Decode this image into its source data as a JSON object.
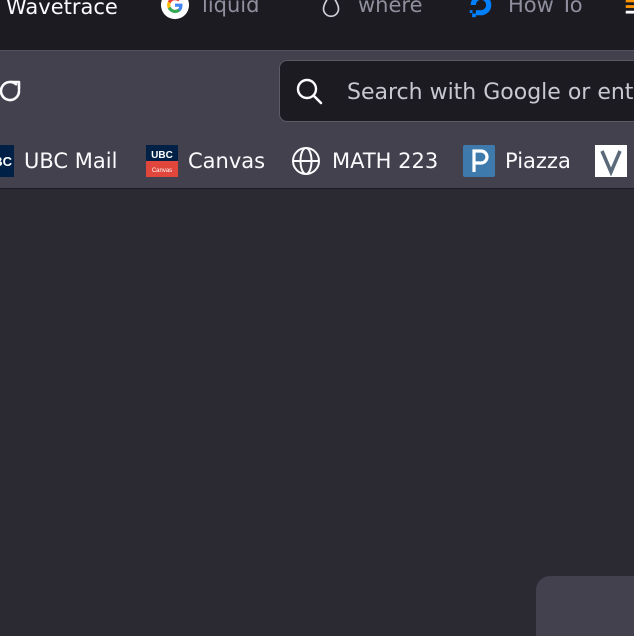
{
  "tabs": [
    {
      "title": "Wavetrace",
      "icon": "wavetrace-favicon"
    },
    {
      "title": "liquid",
      "icon": "google-favicon"
    },
    {
      "title": "where",
      "icon": "drop-favicon"
    },
    {
      "title": "How To",
      "icon": "digitalocean-favicon"
    },
    {
      "title": "",
      "icon": "partial-favicon"
    }
  ],
  "toolbar": {
    "reload_icon": "reload-icon",
    "search_placeholder": "Search with Google or enter address"
  },
  "bookmarks": [
    {
      "label": "UBC Mail",
      "icon": "ubc-favicon"
    },
    {
      "label": "Canvas",
      "icon": "ubc-canvas-favicon",
      "icon_text_top": "UBC",
      "icon_text_bottom": "Canvas"
    },
    {
      "label": "MATH 223",
      "icon": "globe-icon"
    },
    {
      "label": "Piazza",
      "icon": "piazza-favicon"
    },
    {
      "label": "",
      "icon": "v-favicon"
    }
  ],
  "colors": {
    "tabstrip_bg": "#1c1b22",
    "toolbar_bg": "#42414d",
    "content_bg": "#2b2a33",
    "text": "#fbfbfe"
  }
}
